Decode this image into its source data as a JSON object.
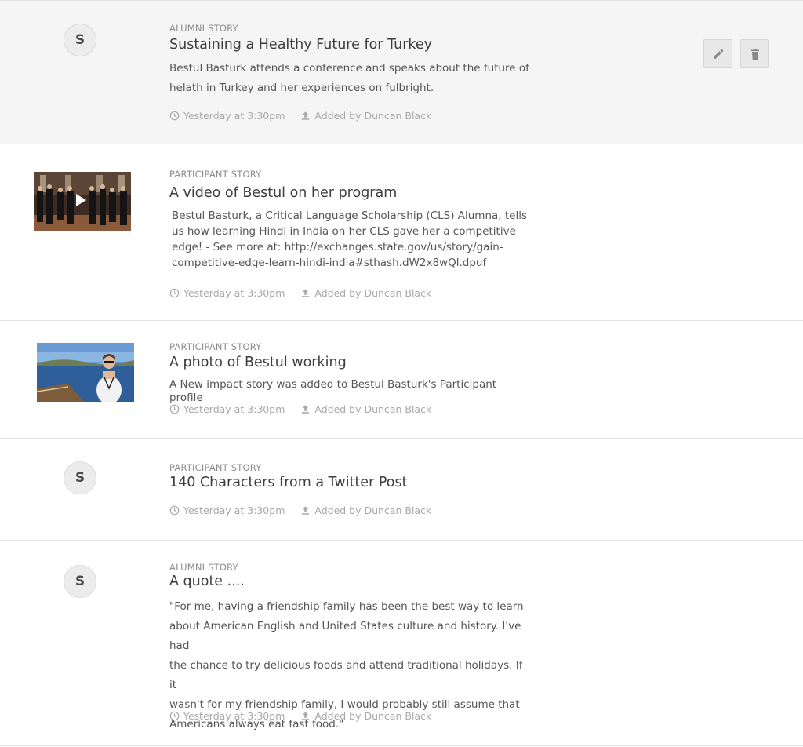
{
  "items": [
    {
      "category": "ALUMNI STORY",
      "title": "Sustaining a Healthy Future for Turkey",
      "description_lines": [
        "Bestul Basturk attends a conference and speaks about the future of",
        "helath in Turkey and her experiences on fulbright."
      ],
      "avatar_letter": "S",
      "time": "Yesterday at 3:30pm",
      "added_by": "Added by Duncan Black",
      "actions": {
        "edit_icon": "pencil-icon",
        "delete_icon": "trash-icon"
      }
    },
    {
      "category": "PARTICIPANT STORY",
      "title": "A video of Bestul on her program",
      "description_lines": [
        "Bestul Basturk, a Critical Language Scholarship (CLS) Alumna, tells",
        "us how learning Hindi in India on her CLS gave her a competitive",
        "edge! - See more at: http://exchanges.state.gov/us/story/gain-",
        "competitive-edge-learn-hindi-india#sthash.dW2x8wQl.dpuf"
      ],
      "thumbnail": "video-thumbnail",
      "time": "Yesterday at 3:30pm",
      "added_by": "Added by Duncan Black"
    },
    {
      "category": "PARTICIPANT STORY",
      "title": "A photo of Bestul working",
      "description_lines": [
        "A New impact story was added to Bestul Basturk's Participant profile"
      ],
      "thumbnail": "photo-thumbnail",
      "time": "Yesterday at 3:30pm",
      "added_by": "Added by Duncan Black"
    },
    {
      "category": "PARTICIPANT STORY",
      "title": "140 Characters from a Twitter Post",
      "description_lines": [],
      "avatar_letter": "S",
      "time": "Yesterday at 3:30pm",
      "added_by": "Added by Duncan Black"
    },
    {
      "category": "ALUMNI STORY",
      "title": "A quote ....",
      "description_lines": [
        "\"For me, having a friendship family has been the best way to learn",
        "about American English and United States culture and history. I've had",
        "the chance to try delicious foods and attend traditional holidays. If it",
        "wasn't for my friendship family, I would probably still assume that",
        "Americans always eat fast food.\""
      ],
      "avatar_letter": "S",
      "time": "Yesterday at 3:30pm",
      "added_by": "Added by Duncan Black"
    }
  ],
  "colors": {
    "meta_gray": "#a8a8a8",
    "highlight_bg": "#f5f5f5",
    "divider": "#e2e2e2"
  }
}
